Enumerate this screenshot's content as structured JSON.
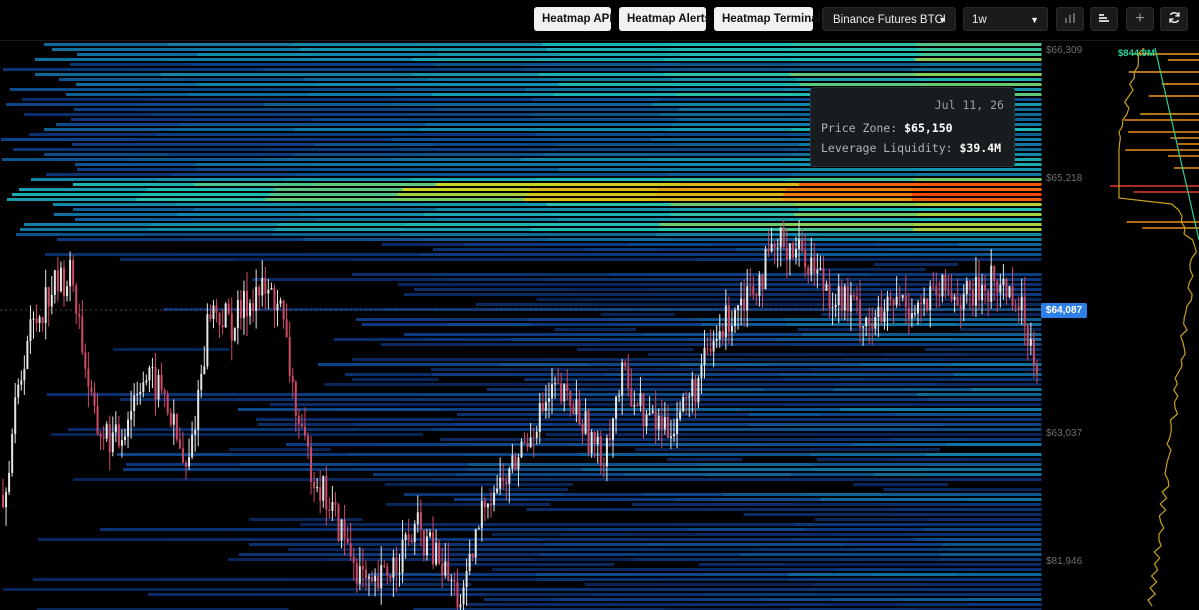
{
  "toolbar": {
    "heatmap_api": "Heatmap API",
    "heatmap_alerts": "Heatmap Alerts",
    "heatmap_terminal": "Heatmap Terminal",
    "exchange_select": "Binance Futures BTCUSDT",
    "timeframe_select": "1w",
    "icons": [
      "bar-chart-icon",
      "sort-bars-icon",
      "plus-icon",
      "refresh-icon"
    ]
  },
  "price_axis": {
    "labels": [
      "$66,309",
      "$65,218",
      "$63,037",
      "$81,946"
    ],
    "current_price": "$64,087"
  },
  "liquidity_profile": {
    "peak_label": "$844.9M"
  },
  "tooltip": {
    "date": "Jul 11, 26",
    "price_zone_label": "Price Zone:",
    "price_zone_value": "$65,150",
    "leverage_label": "Leverage Liquidity:",
    "leverage_value": "$39.4M"
  },
  "colors": {
    "background": "#000000",
    "price_tag": "#2f7fe8",
    "candle_up": "#e8e8e8",
    "candle_down": "#d0506a",
    "peak_label": "#22d39a"
  },
  "chart_data": {
    "type": "heatmap",
    "title": "",
    "y_axis_ticks": [
      "$66,309",
      "$65,218",
      "$63,037",
      "$81,946"
    ],
    "current_price": "$64,087",
    "price_series_close_approx": [
      63000,
      63900,
      64200,
      64300,
      63400,
      63300,
      63700,
      63600,
      63100,
      64100,
      64000,
      64200,
      64150,
      63300,
      63000,
      62700,
      62400,
      62600,
      62800,
      62600,
      62350,
      63000,
      63100,
      63400,
      63600,
      63500,
      63200,
      63700,
      63450,
      63400,
      63600,
      63900,
      64150,
      64300,
      64500,
      64400,
      64200,
      64100,
      64000,
      64150,
      64100,
      64200,
      64150,
      64250,
      64200,
      63800
    ]
  }
}
